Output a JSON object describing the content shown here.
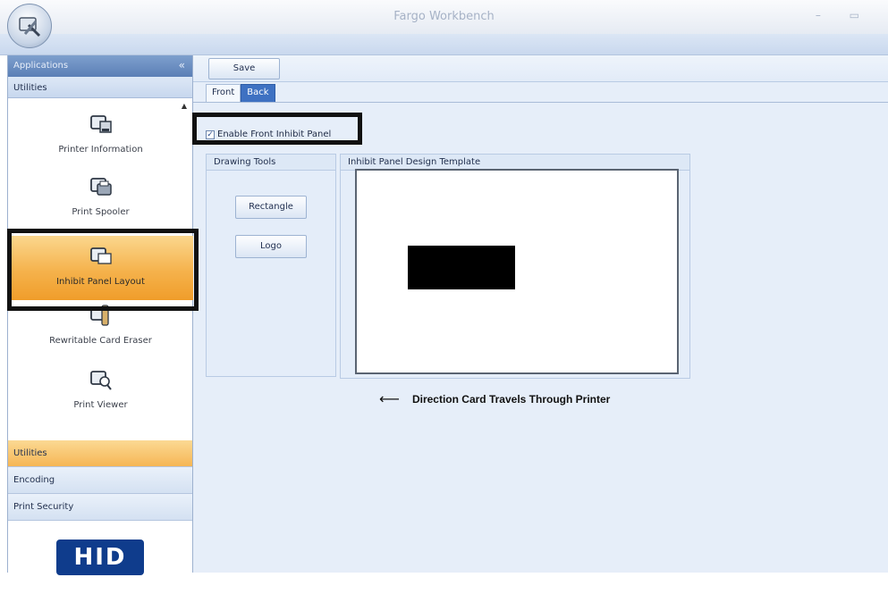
{
  "window": {
    "title": "Fargo Workbench",
    "controls": "– ▭"
  },
  "sidebar": {
    "header": "Applications",
    "header_arrow": "«",
    "section": "Utilities",
    "tools": [
      {
        "label": "Printer Information"
      },
      {
        "label": "Print Spooler"
      },
      {
        "label": "Inhibit Panel Layout"
      },
      {
        "label": "Rewritable Card Eraser"
      },
      {
        "label": "Print Viewer"
      }
    ],
    "accordion": [
      "Utilities",
      "Encoding",
      "Print Security"
    ],
    "logo": "HID"
  },
  "toolbar": {
    "save_label": "Save"
  },
  "tabs": [
    {
      "label": "Front"
    },
    {
      "label": "Back"
    }
  ],
  "enable_checkbox": {
    "label": "Enable Front Inhibit Panel",
    "checked": true,
    "mark": "✓"
  },
  "drawing_tools": {
    "title": "Drawing Tools",
    "rectangle": "Rectangle",
    "logo": "Logo"
  },
  "template": {
    "title": "Inhibit Panel Design Template"
  },
  "direction": {
    "arrow": "⟵",
    "text": "Direction Card Travels Through Printer"
  },
  "colors": {
    "selected_gradient": "#f5b24c",
    "accent_blue": "#3e71c2",
    "hid_blue": "#0f3c8c",
    "annotation_box": "#111111"
  },
  "icons": [
    "app-logo-icon",
    "printer-info-icon",
    "print-spooler-icon",
    "inhibit-panel-icon",
    "card-eraser-icon",
    "print-viewer-icon"
  ]
}
